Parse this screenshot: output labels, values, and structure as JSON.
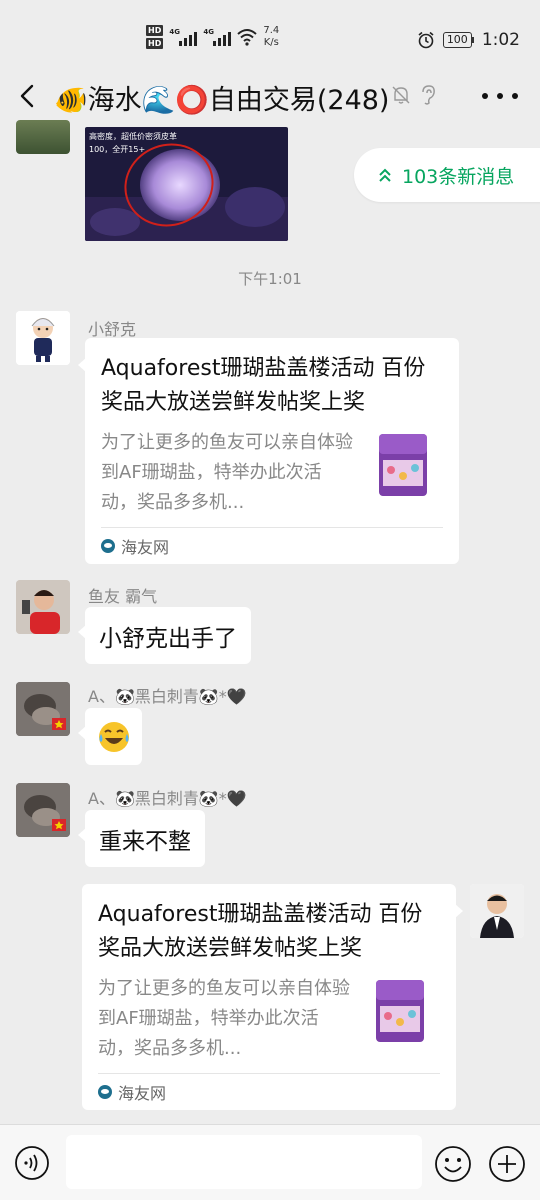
{
  "status_bar": {
    "network_hd_1": "HD",
    "network_hd_2": "HD",
    "signal_1_label": "4G",
    "signal_2_label": "4G",
    "speed_value": "7.4",
    "speed_unit": "K/s",
    "battery_level": "100",
    "time": "1:02"
  },
  "header": {
    "title": "🐠海水🌊⭕自由交易(248)"
  },
  "new_messages_pill": {
    "label": "103条新消息"
  },
  "photo_message": {
    "caption_line1": "高密度，超低价密须皮革",
    "caption_line2": "100，全开15+"
  },
  "timestamp": "下午1:01",
  "messages": [
    {
      "sender": "小舒克",
      "card": {
        "title": "Aquaforest珊瑚盐盖楼活动 百份奖品大放送尝鲜发帖奖上奖",
        "description": "为了让更多的鱼友可以亲自体验到AF珊瑚盐，特举办此次活动，奖品多多机...",
        "source": "海友网"
      }
    },
    {
      "sender": "鱼友 霸气",
      "text": "小舒克出手了"
    },
    {
      "sender": "A、🐼黑白刺青🐼*🖤",
      "text": "😂"
    },
    {
      "sender": "A、🐼黑白刺青🐼*🖤",
      "text": "重来不整"
    },
    {
      "sender": "",
      "card": {
        "title": "Aquaforest珊瑚盐盖楼活动 百份奖品大放送尝鲜发帖奖上奖",
        "description": "为了让更多的鱼友可以亲自体验到AF珊瑚盐，特举办此次活动，奖品多多机...",
        "source": "海友网"
      }
    }
  ],
  "input_bar": {
    "placeholder": ""
  },
  "colors": {
    "background": "#ededed",
    "bubble": "#ffffff",
    "accent_green": "#07a55f",
    "muted_text": "#888888"
  }
}
